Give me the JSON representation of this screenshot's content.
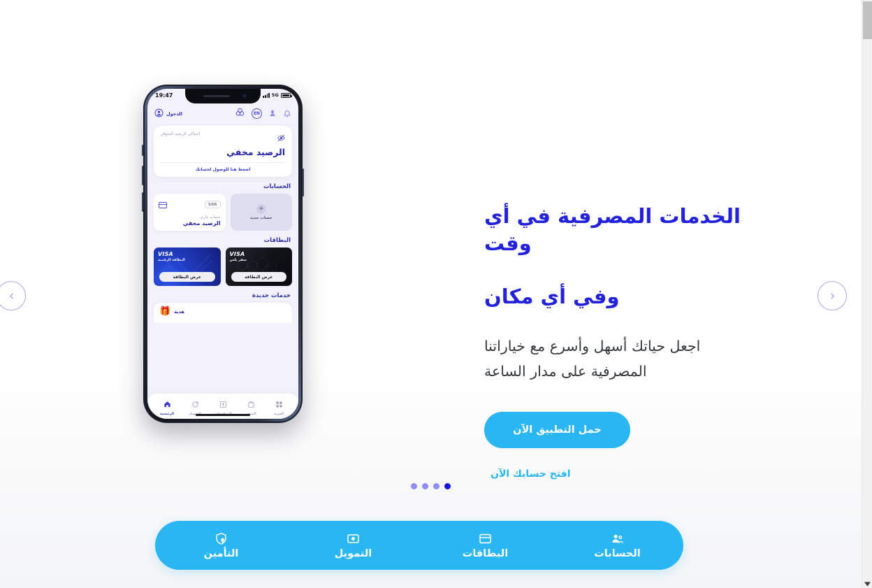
{
  "hero": {
    "headline_line1": "الخدمات المصرفية في أي وقت",
    "headline_line2": "وفي أي مكان",
    "subhead_line1": "اجعل حياتك أسهل وأسرع مع خياراتنا",
    "subhead_line2": "المصرفية على مدار الساعة",
    "cta_label": "حمل التطبيق الآن",
    "secondary_link": "افتح حسابك الآن",
    "headline_color": "#2222dd",
    "accent_color": "#29b6f2"
  },
  "carousel": {
    "prev_icon": "chevron-left-icon",
    "next_icon": "chevron-right-icon",
    "dots": [
      {
        "active": false
      },
      {
        "active": false
      },
      {
        "active": false
      },
      {
        "active": true
      }
    ],
    "active_index": 3,
    "total": 4,
    "dot_color": "#8f8ef5",
    "dot_active_color": "#1515e0"
  },
  "quickbar": {
    "items": [
      {
        "label": "الحسابات",
        "icon": "accounts-people-icon"
      },
      {
        "label": "البطاقات",
        "icon": "card-icon"
      },
      {
        "label": "التمويل",
        "icon": "financing-money-icon"
      },
      {
        "label": "التأمين",
        "icon": "insurance-shield-lock-icon"
      }
    ]
  },
  "phone": {
    "status": {
      "time": "19:47",
      "network": "5G",
      "signal_icon": "signal-bars-icon",
      "battery_icon": "battery-full-icon"
    },
    "header": {
      "login_label": "الدخول",
      "avatar_icon": "user-avatar-icon",
      "logo_icon": "bank-logo-icon",
      "lang_badge": "EN",
      "assistant_icon": "assistant-icon",
      "bell_icon": "bell-icon"
    },
    "balance": {
      "label": "إجمالي الرصيد المتوفر",
      "amount": "الرصيد مخفي",
      "eye_icon": "eye-off-icon",
      "cta": "اضغط هنا للوصول لحسابك"
    },
    "accounts": {
      "title": "الحسابات",
      "card": {
        "currency": "SAR",
        "icon": "card-chip-icon",
        "subtitle": "حساب جاري",
        "value": "الرصيد مخفي"
      },
      "new_account": {
        "label": "حساب جديد",
        "plus_icon": "plus-icon"
      }
    },
    "cards": {
      "title": "البطاقات",
      "items": [
        {
          "brand": "VISA",
          "name": "البطاقة الرقمية",
          "button": "عرض البطاقة",
          "style": "blue"
        },
        {
          "brand": "VISA",
          "name": "سفر بلس",
          "button": "عرض البطاقة",
          "style": "black"
        }
      ]
    },
    "services": {
      "title": "خدمات جديدة",
      "item_label": "هدية",
      "item_icon": "gift-icon"
    },
    "bottom_nav": [
      {
        "label": "الرئيسية",
        "icon": "home-icon",
        "active": true
      },
      {
        "label": "التحويل",
        "icon": "transfer-icon",
        "active": false
      },
      {
        "label": "المدفوعات",
        "icon": "payments-icon",
        "active": false
      },
      {
        "label": "المتجر",
        "icon": "store-icon",
        "active": false
      },
      {
        "label": "المزيد",
        "icon": "grid-more-icon",
        "active": false
      }
    ]
  },
  "scrollbar": {
    "down_arrow_icon": "scroll-down-arrow-icon"
  }
}
